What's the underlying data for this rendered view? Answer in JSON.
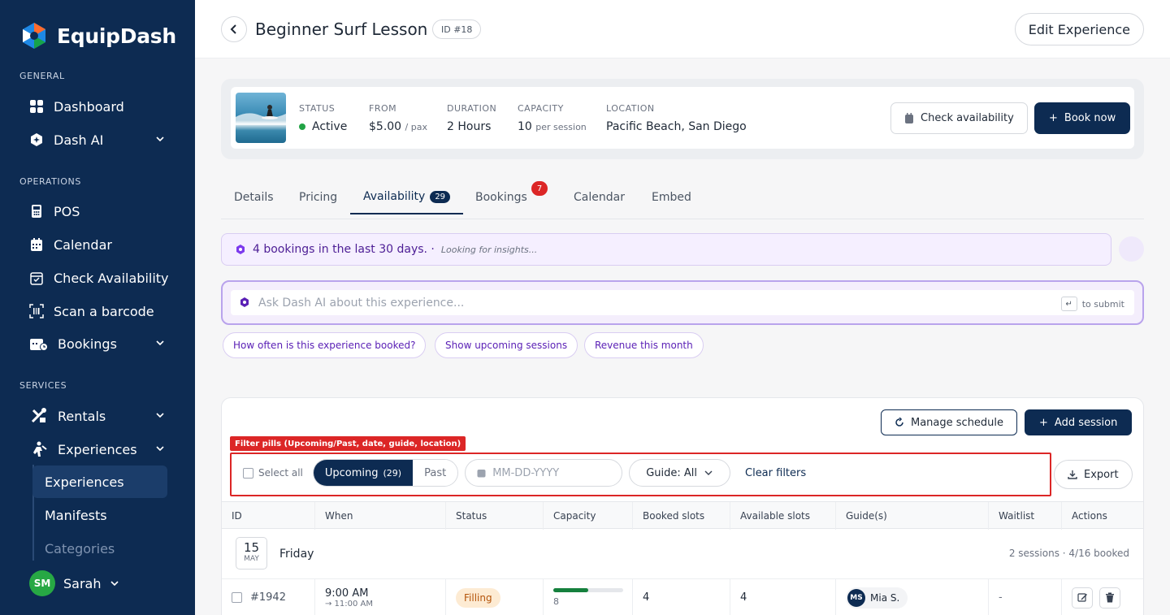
{
  "brand": {
    "name": "EquipDash"
  },
  "sidebar": {
    "sections": {
      "general": "GENERAL",
      "operations": "OPERATIONS",
      "services": "SERVICES"
    },
    "items": {
      "dashboard": "Dashboard",
      "dash_ai": "Dash AI",
      "pos": "POS",
      "calendar": "Calendar",
      "check_availability": "Check Availability",
      "scan_barcode": "Scan a barcode",
      "bookings": "Bookings",
      "rentals": "Rentals",
      "experiences": "Experiences"
    },
    "subitems": {
      "experiences": "Experiences",
      "manifests": "Manifests",
      "categories": "Categories"
    },
    "user": {
      "initials": "SM",
      "name": "Sarah"
    }
  },
  "header": {
    "title": "Beginner Surf Lesson",
    "id_badge": "ID #18",
    "edit_label": "Edit Experience"
  },
  "summary": {
    "status_label": "STATUS",
    "status_value": "Active",
    "from_label": "FROM",
    "from_value": "$5.00",
    "from_unit": "/ pax",
    "duration_label": "DURATION",
    "duration_value": "2 Hours",
    "capacity_label": "CAPACITY",
    "capacity_value": "10",
    "capacity_unit": "per session",
    "location_label": "LOCATION",
    "location_value": "Pacific Beach, San Diego",
    "check_label": "Check availability",
    "book_label": "Book now"
  },
  "tabs": {
    "details": "Details",
    "pricing": "Pricing",
    "availability": "Availability",
    "availability_count": "29",
    "bookings": "Bookings",
    "bookings_badge": "7",
    "calendar": "Calendar",
    "embed": "Embed"
  },
  "insight": {
    "text": "4 bookings in the last 30 days. ·",
    "sub": "Looking for insights..."
  },
  "ask": {
    "placeholder": "Ask Dash AI about this experience...",
    "hint": "to submit"
  },
  "chips": [
    "How often is this experience booked?",
    "Show upcoming sessions",
    "Revenue this month"
  ],
  "schedule": {
    "manage_label": "Manage schedule",
    "add_label": "Add session",
    "export_label": "Export"
  },
  "annotation": {
    "label": "Filter pills (Upcoming/Past, date, guide, location)"
  },
  "filters": {
    "select_all": "Select all",
    "upcoming": "Upcoming",
    "upcoming_count": "(29)",
    "past": "Past",
    "date_placeholder": "MM-DD-YYYY",
    "guide": "Guide: All",
    "clear": "Clear filters"
  },
  "table": {
    "headers": [
      "ID",
      "When",
      "Status",
      "Capacity",
      "Booked slots",
      "Available slots",
      "Guide(s)",
      "Waitlist",
      "Actions"
    ],
    "day": {
      "date": "15",
      "month": "MAY",
      "weekday": "Friday",
      "summary": "2 sessions · 4/16 booked"
    },
    "rows": [
      {
        "id": "#1942",
        "time": "9:00 AM",
        "end": "→ 11:00 AM",
        "status": "Filling",
        "capacity": "8",
        "booked": "4",
        "available": "4",
        "guide_initials": "MS",
        "guide": "Mia S.",
        "waitlist": "-",
        "fill": 0.5
      }
    ]
  },
  "colors": {
    "navy": "#0d2b52",
    "purple": "#5b21b6",
    "annotation": "#dc2626",
    "green": "#15803d"
  }
}
